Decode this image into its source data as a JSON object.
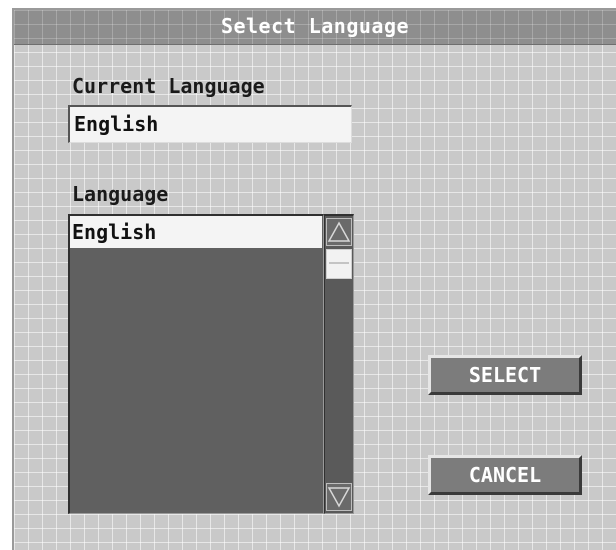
{
  "window": {
    "title": "Select Language"
  },
  "current_language": {
    "label": "Current Language",
    "value": "English"
  },
  "language_list": {
    "label": "Language",
    "items": [
      "English"
    ],
    "selected": "English"
  },
  "buttons": {
    "select_label": "SELECT",
    "cancel_label": "CANCEL"
  },
  "icons": {
    "scroll_up": "triangle-up-icon",
    "scroll_down": "triangle-down-icon"
  },
  "colors": {
    "dialog_background": "#c9c9c9",
    "title_bar": "#8e8e8e",
    "list_background": "#606060",
    "button_face": "#7c7c7c",
    "text_dark": "#111111",
    "text_light": "#ffffff"
  }
}
